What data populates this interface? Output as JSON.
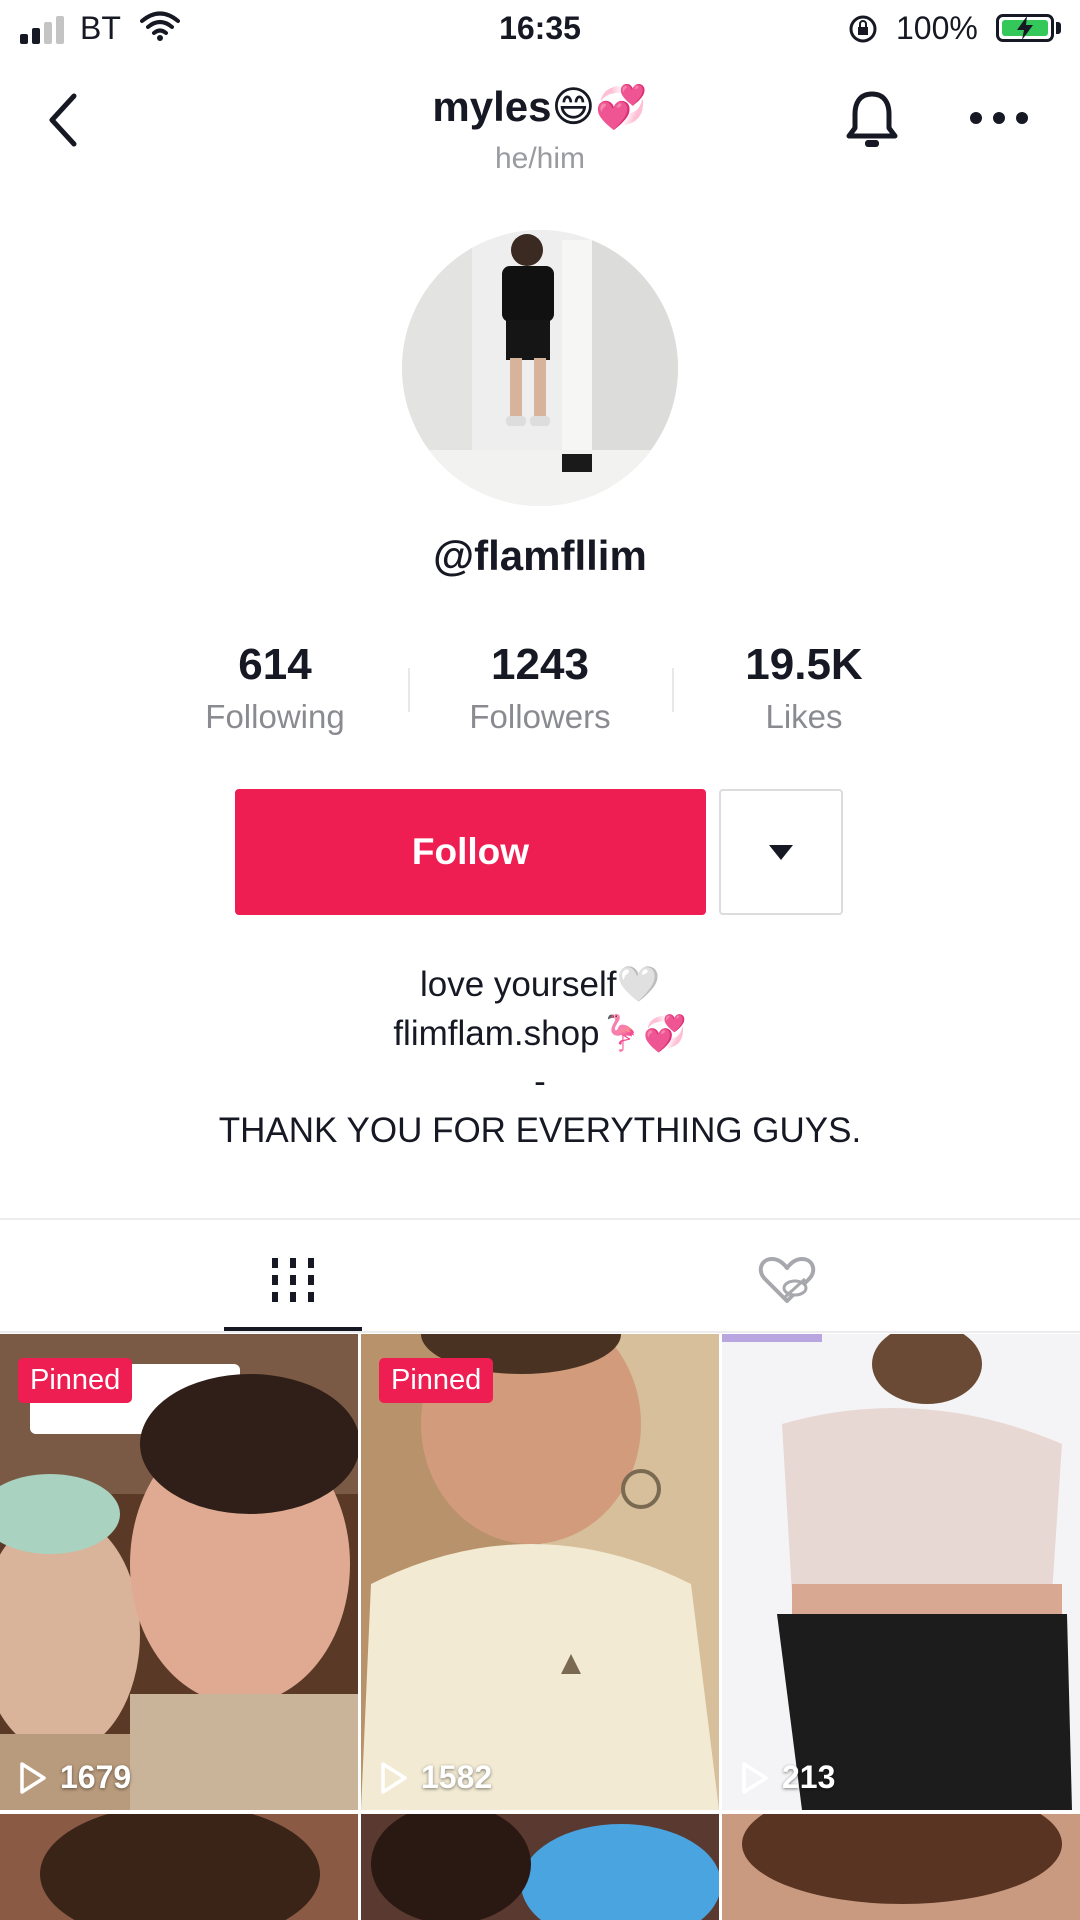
{
  "status_bar": {
    "carrier": "BT",
    "time": "16:35",
    "battery_percent": "100%",
    "signal_bars": 2,
    "battery_charging": true,
    "battery_color": "#34c759"
  },
  "header": {
    "title": "myles😄💞",
    "pronouns": "he/him",
    "icons": [
      "chevron-left-icon",
      "bell-icon",
      "more-icon"
    ]
  },
  "profile": {
    "handle": "@flamfllim"
  },
  "stats": [
    {
      "value": "614",
      "label": "Following"
    },
    {
      "value": "1243",
      "label": "Followers"
    },
    {
      "value": "19.5K",
      "label": "Likes"
    }
  ],
  "actions": {
    "follow_label": "Follow",
    "follow_color": "#ee1d52"
  },
  "bio": {
    "line1": "love yourself🤍",
    "line2": "flimflam.shop🦩💞",
    "line3": "-",
    "line4": "THANK YOU FOR EVERYTHING GUYS."
  },
  "tabs": [
    {
      "name": "videos",
      "icon": "grid-icon",
      "selected": true
    },
    {
      "name": "liked",
      "icon": "liked-hidden-icon",
      "selected": false
    }
  ],
  "videos": [
    {
      "pinned_label": "Pinned",
      "views": "1679"
    },
    {
      "pinned_label": "Pinned",
      "views": "1582"
    },
    {
      "pinned_label": "",
      "views": "213"
    }
  ]
}
